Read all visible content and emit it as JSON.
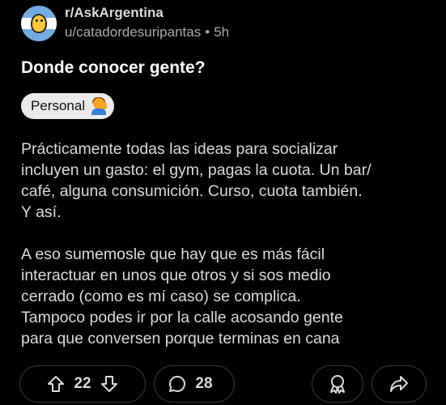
{
  "post": {
    "subreddit": "r/AskArgentina",
    "username": "u/catadordesuripantas",
    "separator": "•",
    "time": "5h",
    "title": "Donde conocer gente?",
    "flair": "Personal",
    "paragraphs": [
      "Prácticamente todas las ideas para socializar\nincluyen un gasto: el gym, pagas la cuota. Un bar/\ncafé, alguna consumición. Curso, cuota también.\nY así.",
      "A eso sumemosle que hay que es más fácil\ninteractuar en unos que otros y si sos medio\ncerrado (como es mí caso) se complica.\nTampoco podes ir por la calle acosando gente\npara que conversen porque terminas en cana"
    ]
  },
  "actions": {
    "upvotes": "22",
    "comments": "28"
  },
  "icons": {
    "avatar": "subreddit-avatar-argentina",
    "flair_emoji": "person-raising-hand",
    "upvote": "upvote-arrow-icon",
    "downvote": "downvote-arrow-icon",
    "comment": "comment-bubble-icon",
    "award": "award-icon",
    "share": "share-icon"
  },
  "colors": {
    "background": "#000000",
    "text": "#d7dadc",
    "muted": "#a8aaab",
    "flair_bg": "#eaeaea",
    "border": "#343536"
  }
}
